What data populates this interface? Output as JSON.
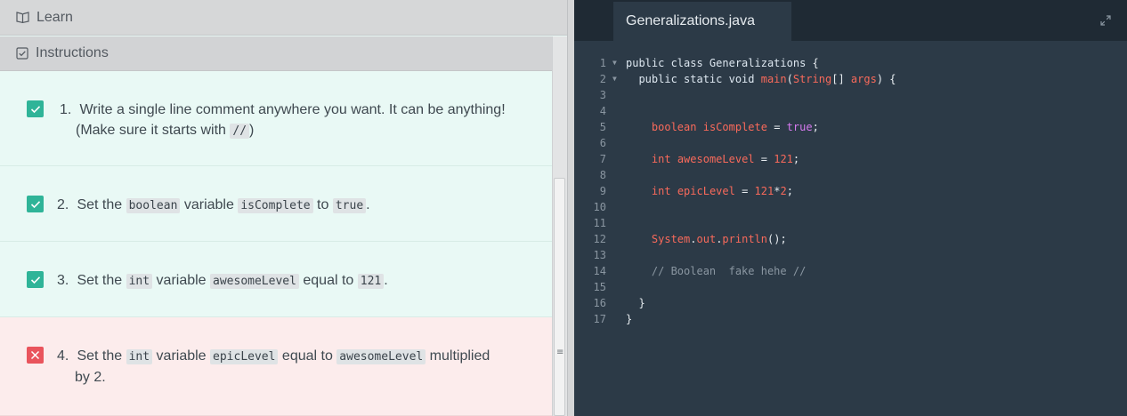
{
  "left": {
    "learn_label": "Learn",
    "instructions_label": "Instructions",
    "items": [
      {
        "num": "1.",
        "status": "ok",
        "line1": "Write a single line comment anywhere you want. It can be anything!",
        "line2_pre": "(Make sure it starts with ",
        "code": "//",
        "line2_post": ")"
      },
      {
        "num": "2.",
        "status": "ok",
        "p1": "Set the ",
        "c1": "boolean",
        "p2": " variable ",
        "c2": "isComplete",
        "p3": " to ",
        "c3": "true",
        "p4": "."
      },
      {
        "num": "3.",
        "status": "ok",
        "p1": "Set the ",
        "c1": "int",
        "p2": " variable ",
        "c2": "awesomeLevel",
        "p3": " equal to ",
        "c3": "121",
        "p4": "."
      },
      {
        "num": "4.",
        "status": "fail",
        "p1": "Set the ",
        "c1": "int",
        "p2": " variable ",
        "c2": "epicLevel",
        "p3": " equal to ",
        "c3": "awesomeLevel",
        "p4": " multiplied",
        "line2": "by 2."
      }
    ]
  },
  "editor": {
    "tab_title": "Generalizations.java",
    "line_numbers": [
      "1",
      "2",
      "3",
      "4",
      "5",
      "6",
      "7",
      "8",
      "9",
      "10",
      "11",
      "12",
      "13",
      "14",
      "15",
      "16",
      "17"
    ],
    "lines": {
      "l1": [
        "public class ",
        "Generalizations",
        " {"
      ],
      "l2": [
        "  public static void ",
        "main",
        "(",
        "String",
        "[] ",
        "args",
        ") {"
      ],
      "l5": [
        "    ",
        "boolean",
        " ",
        "isComplete",
        " = ",
        "true",
        ";"
      ],
      "l7": [
        "    ",
        "int",
        " ",
        "awesomeLevel",
        " = ",
        "121",
        ";"
      ],
      "l9": [
        "    ",
        "int",
        " ",
        "epicLevel",
        " = ",
        "121",
        "*",
        "2",
        ";"
      ],
      "l12": [
        "    ",
        "System",
        ".",
        "out",
        ".",
        "println",
        "();"
      ],
      "l14": [
        "    // Boolean  fake hehe //"
      ],
      "l16": [
        "  }"
      ],
      "l17": [
        "}"
      ]
    }
  },
  "colors": {
    "success": "#2fb498",
    "error": "#e9545c",
    "editor_bg": "#2c3a47"
  }
}
